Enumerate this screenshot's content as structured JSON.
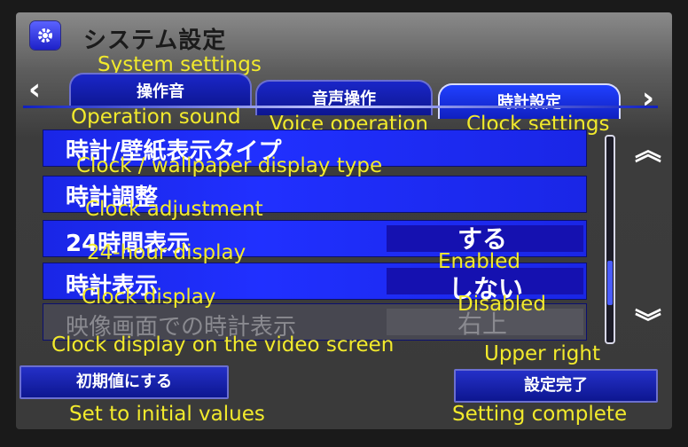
{
  "header": {
    "title": "システム設定",
    "title_translation": "System settings",
    "icon": "gear-icon"
  },
  "tabs": [
    {
      "label": "操作音",
      "translation": "Operation sound",
      "active": false
    },
    {
      "label": "音声操作",
      "translation": "Voice operation",
      "active": false
    },
    {
      "label": "時計設定",
      "translation": "Clock settings",
      "active": true
    }
  ],
  "nav": {
    "prev_icon": "chevron-left-icon",
    "next_icon": "chevron-right-icon",
    "prev": "‹",
    "next": "›"
  },
  "settings": [
    {
      "label": "時計/壁紙表示タイプ",
      "translation": "Clock / wallpaper display type",
      "value": "",
      "value_translation": "",
      "enabled": true
    },
    {
      "label": "時計調整",
      "translation": "Clock adjustment",
      "value": "",
      "value_translation": "",
      "enabled": true
    },
    {
      "label": "24時間表示",
      "translation": "24-hour display",
      "value": "する",
      "value_translation": "Enabled",
      "enabled": true
    },
    {
      "label": "時計表示",
      "translation": "Clock display",
      "value": "しない",
      "value_translation": "Disabled",
      "enabled": true
    },
    {
      "label": "映像画面での時計表示",
      "translation": "Clock display on the video screen",
      "value": "右上",
      "value_translation": "Upper right",
      "enabled": false
    }
  ],
  "scroll": {
    "up": "︽",
    "down": "︾",
    "up_icon": "double-chevron-up-icon",
    "down_icon": "double-chevron-down-icon"
  },
  "buttons": {
    "reset_label": "初期値にする",
    "reset_translation": "Set to initial values",
    "done_label": "設定完了",
    "done_translation": "Setting complete"
  },
  "colors": {
    "accent": "#1a26e6",
    "overlay_text": "#f2ea2c",
    "disabled_row": "#474750"
  }
}
